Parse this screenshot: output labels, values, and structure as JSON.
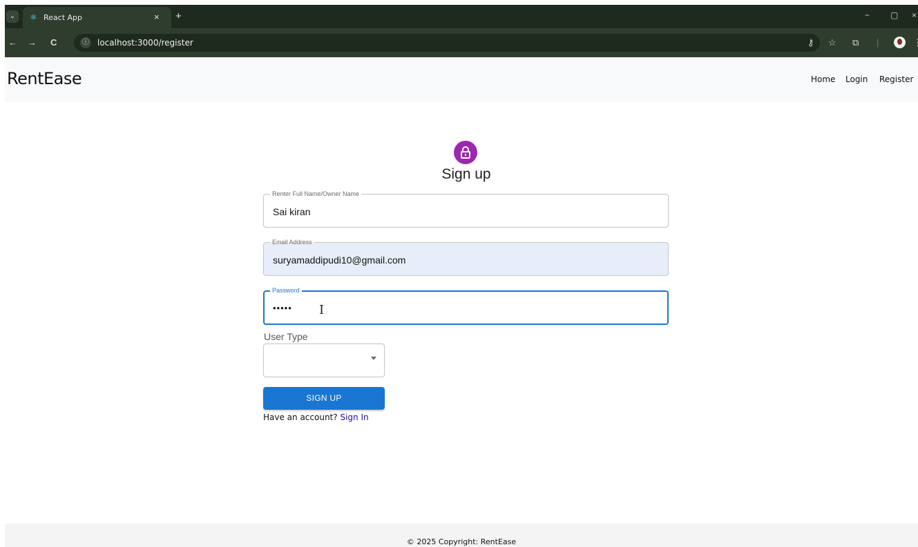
{
  "browser": {
    "tab_title": "React App",
    "tab_close": "×",
    "new_tab": "+",
    "menu_glyph": "⌄",
    "url": "localhost:3000/register",
    "back": "←",
    "forward": "→",
    "reload": "C",
    "info_glyph": "ⓘ",
    "key_glyph": "⚷",
    "star_glyph": "☆",
    "ext_glyph": "⧉",
    "divider": "|",
    "more_glyph": "⋮",
    "minimize": "−",
    "restore": "▢",
    "close_win": "×",
    "colors": {
      "titlebar": "#1f2a1f",
      "toolbar": "#2f3d2f"
    }
  },
  "navbar": {
    "brand": "RentEase",
    "links": [
      "Home",
      "Login",
      "Register"
    ]
  },
  "form": {
    "title": "Sign up",
    "avatar_icon": "lock-outlined-icon",
    "avatar_color": "#9c27b0",
    "fields": {
      "name": {
        "label": "Renter Full Name/Owner Name",
        "value": "Sai kiran"
      },
      "email": {
        "label": "Email Address",
        "value": "suryamaddipudi10@gmail.com"
      },
      "password": {
        "label": "Password",
        "value": "•••••"
      }
    },
    "user_type": {
      "label": "User Type",
      "value": ""
    },
    "submit": "SIGN UP",
    "have_account": "Have an account?",
    "sign_in": "Sign In",
    "accent": "#1976d2"
  },
  "footer": {
    "text": "© 2025 Copyright: RentEase"
  }
}
